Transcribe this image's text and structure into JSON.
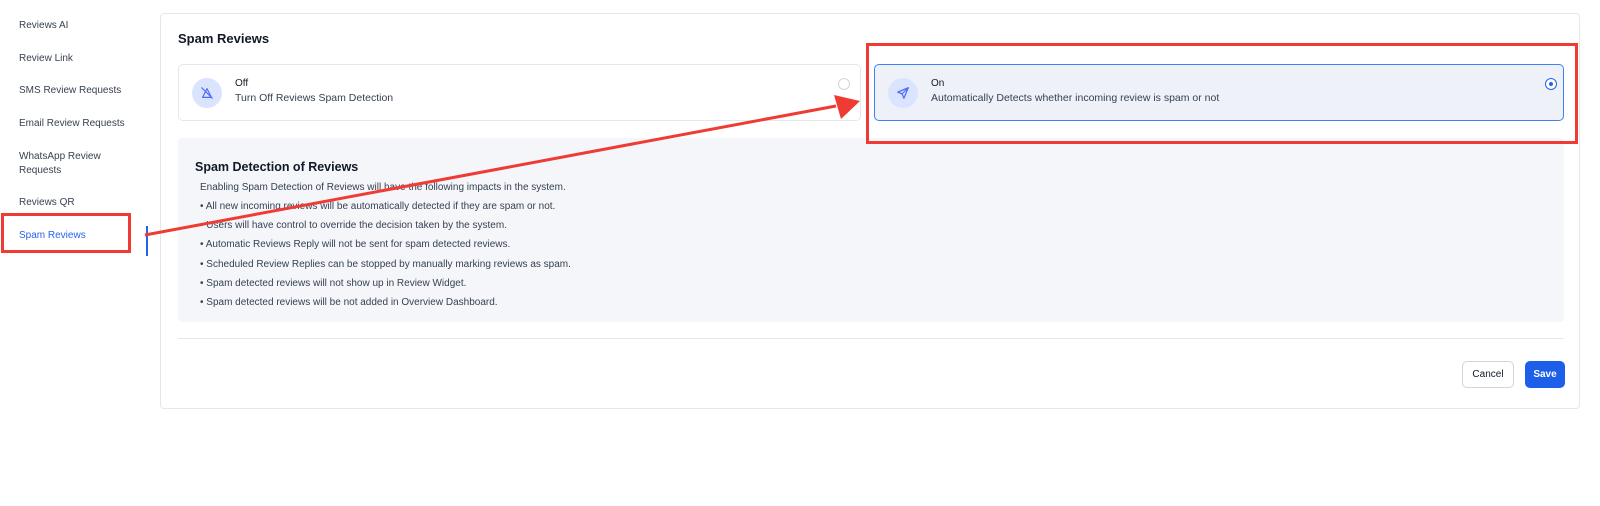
{
  "sidebar": {
    "items": [
      {
        "label": "Reviews AI"
      },
      {
        "label": "Review Link"
      },
      {
        "label": "SMS Review Requests"
      },
      {
        "label": "Email Review Requests"
      },
      {
        "label": "WhatsApp Review Requests"
      },
      {
        "label": "Reviews QR"
      },
      {
        "label": "Spam Reviews"
      }
    ],
    "active": "Spam Reviews"
  },
  "main": {
    "title": "Spam Reviews",
    "options": {
      "off": {
        "title": "Off",
        "description": "Turn Off Reviews Spam Detection",
        "selected": false
      },
      "on": {
        "title": "On",
        "description": "Automatically Detects whether incoming review is spam or not",
        "selected": true
      }
    },
    "info": {
      "title": "Spam Detection of Reviews",
      "intro": "Enabling Spam Detection of Reviews will have the following impacts in the system.",
      "bullets": [
        "• All new incoming reviews will be automatically detected if they are spam or not.",
        "• Users will have control to override the decision taken by the system.",
        "• Automatic Reviews Reply will not be sent for spam detected reviews.",
        "• Scheduled Review Replies can be stopped by manually marking reviews as spam.",
        "• Spam detected reviews will not show up in Review Widget.",
        "• Spam detected reviews will be not added in Overview Dashboard."
      ]
    },
    "buttons": {
      "cancel": "Cancel",
      "save": "Save"
    }
  },
  "colors": {
    "accent": "#2563eb",
    "annotation": "#ef3b33",
    "selected_bg": "#eef2f8"
  },
  "icons": {
    "off_option": "spam-off-icon",
    "on_option": "send-icon"
  }
}
